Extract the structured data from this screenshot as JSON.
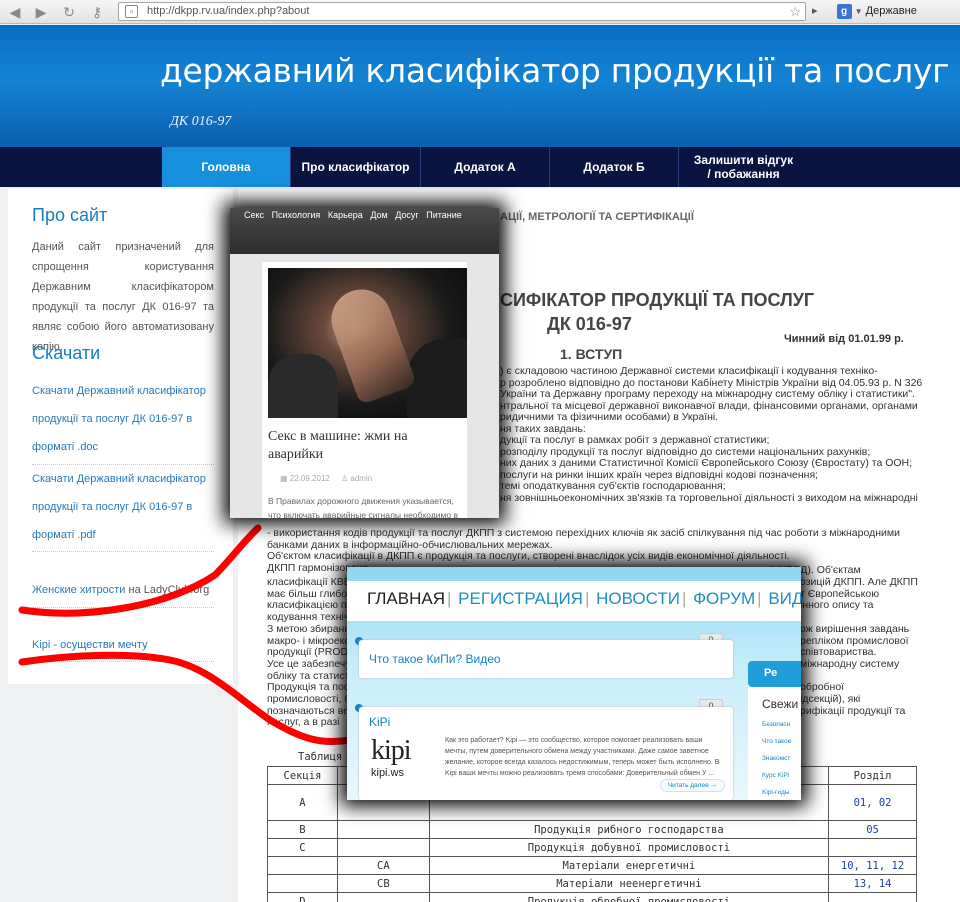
{
  "browser": {
    "url": "http://dkpp.rv.ua/index.php?about",
    "url_domain": "dkpp.rv.ua",
    "search_label": "Державне управлінн"
  },
  "header": {
    "title": "державний класифікатор продукції та послуг",
    "subtitle": "ДК 016-97"
  },
  "menu": [
    {
      "label": "Головна",
      "active": true
    },
    {
      "label": "Про класифікатор",
      "active": false
    },
    {
      "label": "Додаток А",
      "active": false
    },
    {
      "label": "Додаток Б",
      "active": false
    },
    {
      "label": "Залишити відгук / побажання",
      "active": false
    }
  ],
  "sidebar": {
    "about_heading": "Про сайт",
    "about_text": "Даний сайт призначений для спрощення користування Державним класифікатором продукції та послуг ДК 016-97 та являє собою його автоматизовану копію.",
    "download_heading": "Скачати",
    "download_doc": "Скачати Державний класифікатор продукції та послуг ДК 016-97 в форматі .doc",
    "download_pdf": "Скачати Державний класифікатор продукції та послуг ДК 016-97 в форматі .pdf",
    "ad1_link": "Женские хитрости",
    "ad1_suffix": "на LadyClub.org",
    "ad2_link": "Kipi - осуществи мечту"
  },
  "main": {
    "top_heading": "АЦІЇ, МЕТРОЛОГІЇ ТА СЕРТИФІКАЦІЇ",
    "title_line1": "СИФІКАТОР ПРОДУКЦІЇ ТА ПОСЛУГ",
    "title_line2": "ДК 016-97",
    "valid_from": "Чинний від 01.01.99 р.",
    "section_heading": "1. ВСТУП",
    "lines_right": [
      ") є складовою частиною Державної системи класифікації і кодування техніко-",
      "р розроблено відповідно до постанови Кабінету Міністрів України від 04.05.93 р. N 326",
      "України та Державну програму переходу на міжнародну систему обліку і статистики\".",
      "нтральної та місцевої державної виконавчої влади, фінансовими органами, органами",
      "ридичними та фізичними особами) в Україні.",
      "ня таких завдань:",
      "дукції та послуг в рамках робіт з державної статистики;",
      "розподілу продукції та послуг відповідно до системи національних рахунків;",
      "них даних з даними Статистичної Комісії Європейського Союзу (Євростату) та ООН;",
      "послуги на ринки інших країн через відповідні кодові позначення;",
      "темі оподаткування суб'єктів господарювання;",
      "ня зовнішньоекономічних зв'язків та торговельної діяльності з виходом на міжнародні"
    ],
    "lines_full": [
      "- використання кодів продукції та послуг ДКПП з системою перехідних ключів як засіб спілкування під час роботи з міжнародними",
      "банками даних в інформаційно-обчислювальних мережах.",
      "Об'єктом класифікації в ДКПП є продукція та послуги, створені внаслідок усіх видів економічної діяльності.",
      "ДКПП гармонізовано"
    ],
    "line_kved_right": "\" (КВЕД). Об'єктам",
    "lines_left_partial": [
      "класифікації КВЕД",
      "має більш глибок",
      "класифікацією пр",
      "кодування техніч",
      "З метою збирання",
      "макро- і мікроеко",
      "продукції (PROD",
      "Усе це забезпечу",
      "обліку та статист",
      "Продукція та пос",
      "промисловості, б",
      "позначаються ве",
      "послуг, а в разі"
    ],
    "lines_right_partial": [
      "озицій ДКПП. Але ДКПП",
      "т Європейською",
      "інного опису та",
      "",
      "ож вирішення завдань",
      "репліком промислової",
      "співтовариства.",
      "міжнародну систему",
      "",
      "обробної",
      "ідсекцій), які",
      "рифікації продукції та",
      ""
    ]
  },
  "table": {
    "caption": "Таблиця",
    "header": [
      "Секція",
      "",
      "",
      "Розділ"
    ],
    "rows": [
      {
        "section": "A",
        "sub": "",
        "name": "",
        "div": "01, 02"
      },
      {
        "section": "B",
        "sub": "",
        "name": "Продукція рибного господарства",
        "div": "05"
      },
      {
        "section": "C",
        "sub": "",
        "name": "Продукція добувної промисловості",
        "div": ""
      },
      {
        "section": "",
        "sub": "CA",
        "name": "Матеріали енергетичні",
        "div": "10, 11, 12"
      },
      {
        "section": "",
        "sub": "CB",
        "name": "Матеріали неенергетичні",
        "div": "13, 14"
      },
      {
        "section": "D",
        "sub": "",
        "name": "Продукція обробної промисловості",
        "div": ""
      }
    ]
  },
  "popup_ladyclub": {
    "nav": [
      "Секс",
      "Психология",
      "Карьера",
      "Дом",
      "Досуг",
      "Питание"
    ],
    "title": "Секс в машине: жми на аварийки",
    "date": "22.09.2012",
    "author": "admin",
    "excerpt": "В Правилах дорожного движения указывается, что включать аварийные сигналы необходимо в"
  },
  "popup_kipi": {
    "nav": [
      "ГЛАВНАЯ",
      "РЕГИСТРАЦИЯ",
      "НОВОСТИ",
      "ФОРУМ",
      "ВИДЕ"
    ],
    "post1_title": "Что такое КиПи? Видео",
    "post1_count": "0",
    "post2_title": "KiPi",
    "post2_count": "0",
    "logo_text": "kipi",
    "logo_domain": "kipi.ws",
    "description": "Как это работает? Kipi — это сообщество, которое помогает реализовать ваши мечты, путем доверительного обмена между участниками. Даже самое заветное желание, которое всегда казалось недостижимым, теперь может быть исполнено. В Kipi ваши мечты можно реализовать тремя способами: Доверительный обмен У ...",
    "read_more": "Читать далее →",
    "register_btn": "Ре",
    "sidebar_heading": "Свежи",
    "sidebar_links": [
      "Безопасн",
      "Что такое",
      "Знакомст",
      "Курс KiPi",
      "Kipi-гиды"
    ]
  },
  "colors": {
    "header_blue": "#1483d4",
    "menu_dark": "#0a1440",
    "menu_active": "#1690dc",
    "link_blue": "#2a78b8",
    "annotation_red": "#ff0000"
  }
}
